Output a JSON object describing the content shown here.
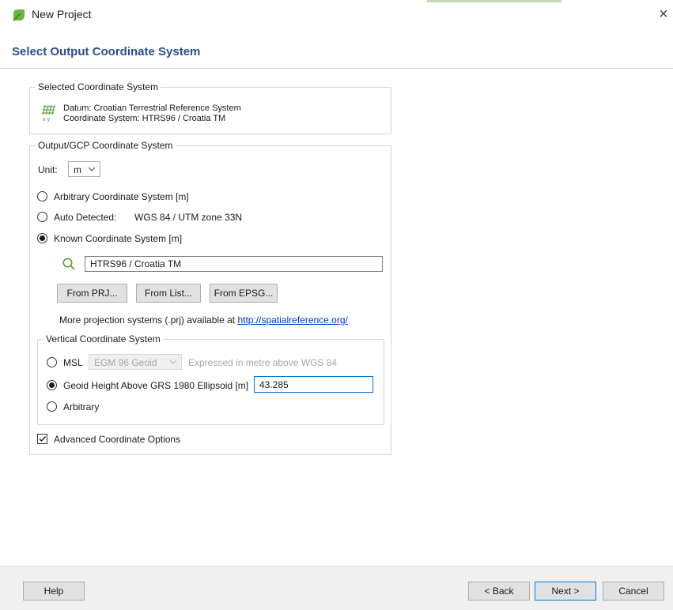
{
  "window": {
    "title": "New Project",
    "close_glyph": "×",
    "app_icon": "green-leaf-icon",
    "close_icon": "close-icon"
  },
  "heading": "Select Output Coordinate System",
  "selected_coordinate_system": {
    "group_title": "Selected Coordinate System",
    "icon": "coordinate-grid-icon",
    "datum": "Datum: Croatian Terrestrial Reference System",
    "coordinate_system": "Coordinate System: HTRS96 / Croatia TM"
  },
  "output_gcp": {
    "group_title": "Output/GCP Coordinate System",
    "unit_label": "Unit:",
    "unit_value": "m",
    "options": {
      "arbitrary": "Arbitrary Coordinate System [m]",
      "auto_detected": "Auto Detected:",
      "auto_detected_value": "WGS 84 / UTM zone 33N",
      "known": "Known Coordinate System [m]"
    },
    "selected_option": "known",
    "search_value": "HTRS96 / Croatia TM",
    "search_icon": "search-icon",
    "buttons": {
      "from_prj": "From PRJ...",
      "from_list": "From List...",
      "from_epsg": "From EPSG..."
    },
    "more_text": "More projection systems (.prj) available at",
    "more_link": "http://spatialreference.org/"
  },
  "vertical": {
    "group_title": "Vertical Coordinate System",
    "msl_label": "MSL",
    "msl_select": "EGM 96 Geoid",
    "msl_note": "Expressed in metre above WGS 84",
    "geoid_label": "Geoid Height Above GRS 1980 Ellipsoid [m]",
    "geoid_value": "43.285",
    "arbitrary_label": "Arbitrary",
    "selected_option": "geoid"
  },
  "advanced": {
    "label": "Advanced Coordinate Options",
    "checked": true
  },
  "footer": {
    "help": "Help",
    "back": "< Back",
    "next": "Next >",
    "cancel": "Cancel"
  },
  "colors": {
    "heading": "#2a4f8a",
    "link": "#0033cc",
    "accent_border": "#0078d7",
    "search_icon": "#5aa02c",
    "app_icon": "#6cb33f"
  }
}
